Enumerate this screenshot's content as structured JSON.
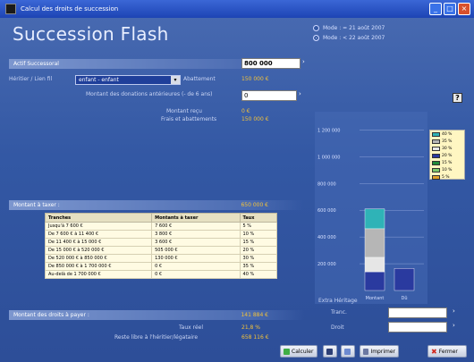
{
  "window": {
    "title": "Calcul des droits de succession"
  },
  "app_title": "Succession Flash",
  "modes": [
    {
      "label": "Mode : = 21 août 2007",
      "selected": false
    },
    {
      "label": "Mode : < 22 août 2007",
      "selected": true
    }
  ],
  "actif_band": {
    "label": "Actif Successoral",
    "value": "800 000"
  },
  "lien": {
    "label": "Héritier / Lien fil",
    "selected": "enfant - enfant",
    "abattement_label": "Abattement",
    "abattement_value": "150 000 €"
  },
  "donations": {
    "label": "Montant des donations antérieures (- de 6 ans)",
    "value": "0"
  },
  "results": [
    {
      "label": "Montant reçu",
      "value": "0 €"
    },
    {
      "label": "Frais et abattements",
      "value": "150 000 €"
    }
  ],
  "part_band": {
    "label": "Montant à taxer :",
    "value": "650 000 €"
  },
  "table": {
    "headers": [
      "Tranches",
      "Montants à taxer",
      "Taux"
    ],
    "rows": [
      [
        "Jusqu'à 7 600 €",
        "7 600 €",
        "5 %"
      ],
      [
        "De 7 600 € à 11 400 €",
        "3 800 €",
        "10 %"
      ],
      [
        "De 11 400 € à 15 000 €",
        "3 600 €",
        "15 %"
      ],
      [
        "De 15 000 € à 520 000 €",
        "505 000 €",
        "20 %"
      ],
      [
        "De 520 000 € à 850 000 €",
        "130 000 €",
        "30 %"
      ],
      [
        "De 850 000 € à 1 700 000 €",
        "0 €",
        "35 %"
      ],
      [
        "Au-delà de 1 700 000 €",
        "0 €",
        "40 %"
      ]
    ]
  },
  "droits_band": {
    "label": "Montant des droits à payer :",
    "value": "141 884 €"
  },
  "taux": [
    {
      "label": "Taux réel",
      "value": "21,8 %"
    },
    {
      "label": "Reste libre à l'héritier/légataire",
      "value": "658 116 €"
    }
  ],
  "chart_data": {
    "type": "bar",
    "stacked": true,
    "categories": [
      "Montant",
      "Dû"
    ],
    "y_ticks": [
      "1 200 000",
      "1 000 000",
      "800 000",
      "600 000",
      "400 000",
      "200 000"
    ],
    "series": [
      {
        "name": "40 %",
        "color": "#2fb3b7",
        "values": [
          148000,
          0
        ]
      },
      {
        "name": "35 %",
        "color": "#b6b6b6",
        "values": [
          214000,
          0
        ]
      },
      {
        "name": "30 %",
        "color": "#e6e6e6",
        "values": [
          108000,
          0
        ]
      },
      {
        "name": "20 %",
        "color": "#2a3a9f",
        "values": [
          140000,
          165000
        ]
      },
      {
        "name": "15 %",
        "color": "#1f8a3a",
        "values": [
          0,
          0
        ]
      },
      {
        "name": "10 %",
        "color": "#7cc96b",
        "values": [
          0,
          0
        ]
      },
      {
        "name": "5 %",
        "color": "#e0a02a",
        "values": [
          0,
          0
        ]
      }
    ],
    "ylim": [
      0,
      1270000
    ]
  },
  "extra": {
    "title": "Extra Héritage",
    "fields": [
      {
        "label": "Tranc.",
        "value": ""
      },
      {
        "label": "Droit",
        "value": ""
      }
    ]
  },
  "toolbar": {
    "calculer": "Calculer",
    "imprimer": "Imprimer",
    "fermer": "Fermer"
  }
}
